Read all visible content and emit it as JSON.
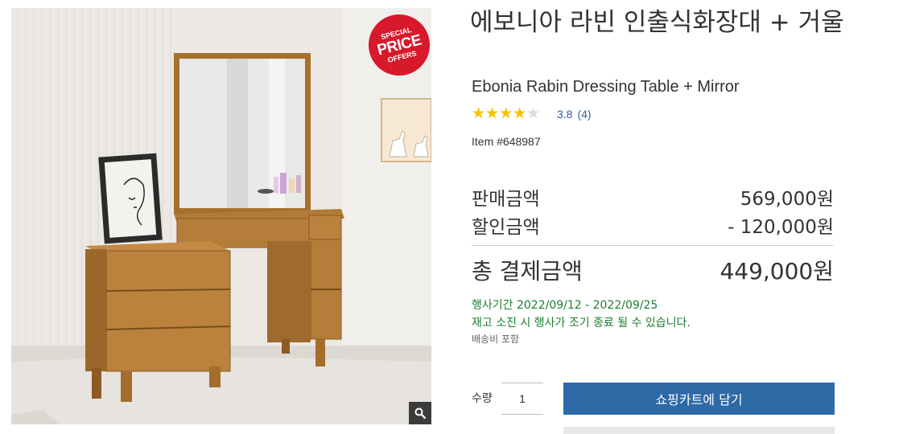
{
  "product": {
    "badge": {
      "line1": "SPECIAL",
      "line2": "PRICE",
      "line3": "OFFERS"
    },
    "title_ko": "에보니아 라빈 인출식화장대 + 거울",
    "title_en": "Ebonia Rabin Dressing Table + Mirror",
    "rating": {
      "value": 3.8,
      "score_text": "3.8",
      "count_text": "(4)",
      "max": 5,
      "star_color": "#f4c400"
    },
    "item_number": "Item #648987"
  },
  "pricing": {
    "sale_label": "판매금액",
    "sale_value": "569,000원",
    "discount_label": "할인금액",
    "discount_value": "- 120,000원",
    "total_label": "총 결제금액",
    "total_value": "449,000원"
  },
  "promotion": {
    "period": "행사기간 2022/09/12 - 2022/09/25",
    "notice": "재고 소진 시 행사가 조기 종료 될 수 있습니다.",
    "shipping": "배송비 포함",
    "color": "#1a7f2e"
  },
  "purchase": {
    "qty_label": "수량",
    "qty_value": "1",
    "cart_button": "쇼핑카트에 담기",
    "button_color": "#2d6aa6"
  },
  "icons": {
    "zoom": "magnifier-icon",
    "stars": "star-icon"
  }
}
